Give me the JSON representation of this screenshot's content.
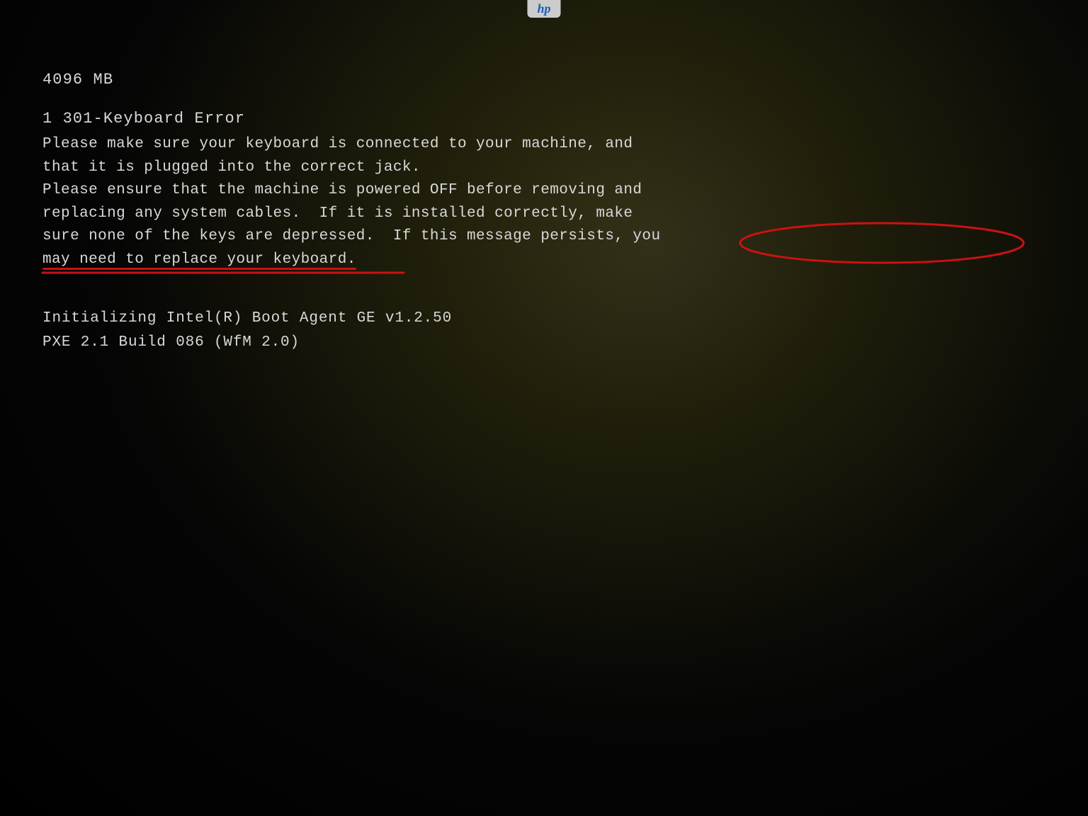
{
  "hp_logo": "hp",
  "screen": {
    "memory_line": "4096 MB",
    "error_title": "1 301-Keyboard Error",
    "error_lines": [
      "Please make sure your keyboard is connected to your machine, and",
      "that it is plugged into the correct jack.",
      "Please ensure that the machine is powered OFF before removing and",
      "replacing any system cables.  If it is installed correctly, make",
      "sure none of the keys are depressed.  If this message persists, you",
      "may need to replace your keyboard."
    ],
    "boot_lines": [
      "Initializing Intel(R) Boot Agent GE v1.2.50",
      "PXE 2.1 Build 086 (WfM 2.0)"
    ]
  }
}
